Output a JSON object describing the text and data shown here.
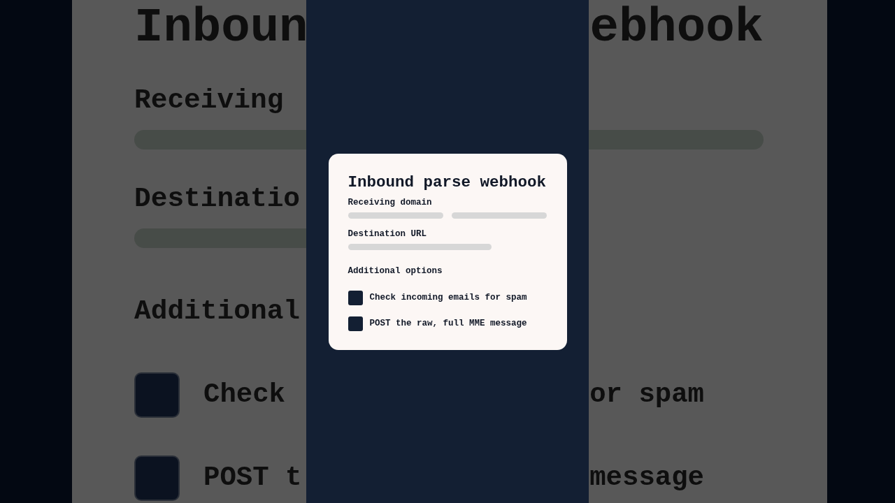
{
  "backdrop": {
    "title_parts": [
      "Inboun",
      "ebhook"
    ],
    "receiving_label": "Receiving",
    "destination_label": "Destinatio",
    "options_label": "Additional",
    "options": [
      {
        "left": "Check",
        "right": "or spam",
        "checked": false
      },
      {
        "left": "POST t",
        "right": "message",
        "checked": false
      }
    ]
  },
  "card": {
    "title": "Inbound parse webhook",
    "fields": [
      {
        "label": "Receiving domain",
        "kind": "split"
      },
      {
        "label": "Destination URL",
        "kind": "single"
      }
    ],
    "options_heading": "Additional options",
    "options": [
      {
        "label": "Check incoming emails for spam",
        "checked": false
      },
      {
        "label": "POST the raw, full MME message",
        "checked": false
      }
    ]
  }
}
